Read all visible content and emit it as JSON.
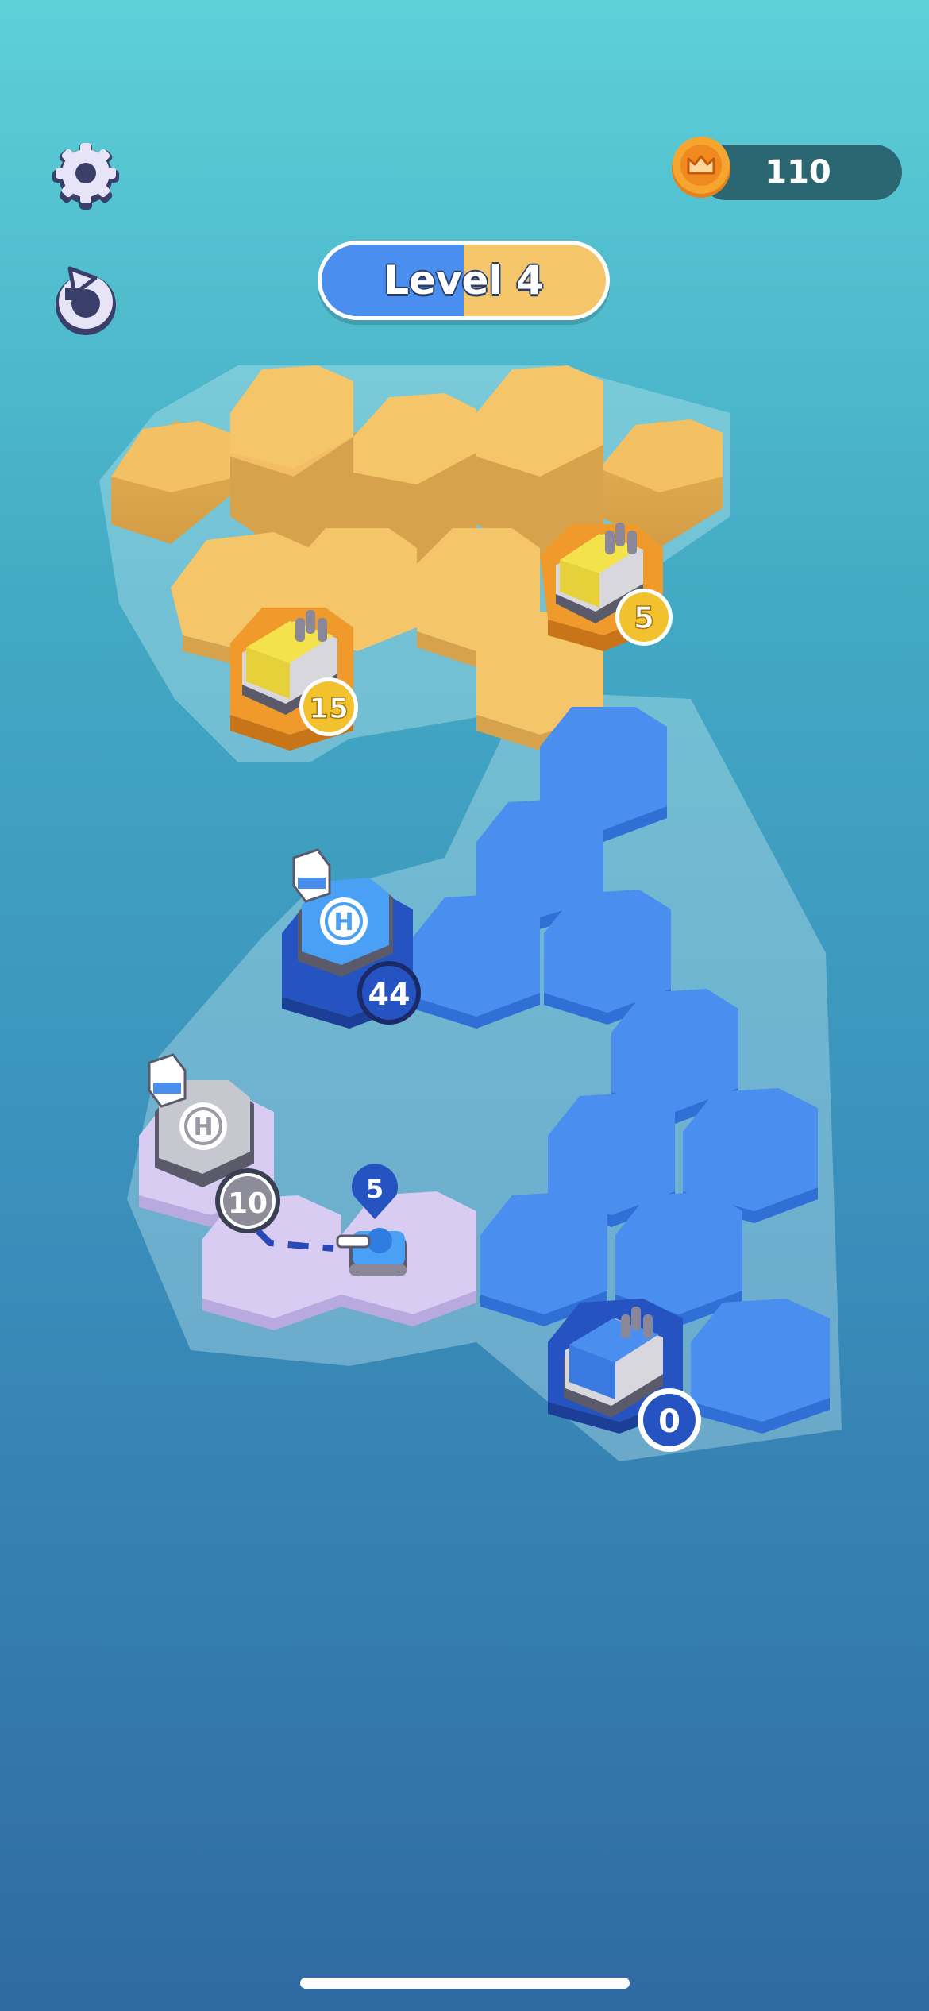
{
  "hud": {
    "level_label": "Level 4",
    "coins": "110",
    "settings_icon": "gear-icon",
    "restart_icon": "restart-icon",
    "coin_icon": "crown-coin-icon"
  },
  "colors": {
    "yellow_team": "#f5c56a",
    "blue_team": "#4a8ff0",
    "neutral": "#d8ccf3"
  },
  "units": {
    "yellow_factory_right": "5",
    "yellow_factory_left": "15",
    "blue_helipad": "44",
    "gray_helipad": "10",
    "tank_marker": "5",
    "blue_factory": "0"
  }
}
